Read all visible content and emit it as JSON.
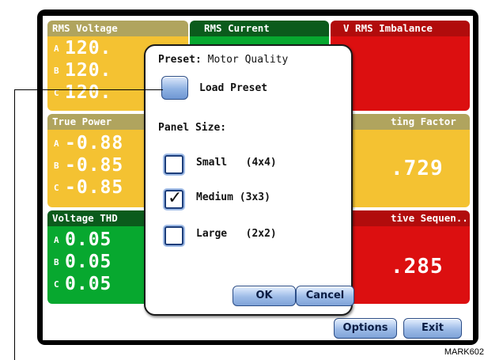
{
  "panels": {
    "rms_voltage": {
      "title": "RMS Voltage",
      "rows": [
        {
          "phase": "A",
          "value": "120."
        },
        {
          "phase": "B",
          "value": "120."
        },
        {
          "phase": "C",
          "value": "120."
        }
      ]
    },
    "rms_current": {
      "title": "RMS Current"
    },
    "v_rms_imbalance": {
      "title": "V RMS Imbalance"
    },
    "true_power": {
      "title": "True Power",
      "rows": [
        {
          "phase": "A",
          "value": "-0.88"
        },
        {
          "phase": "B",
          "value": "-0.85"
        },
        {
          "phase": "C",
          "value": "-0.85"
        }
      ]
    },
    "derating_factor": {
      "title": "ting Factor",
      "value": ".729"
    },
    "voltage_thd": {
      "title": "Voltage THD",
      "rows": [
        {
          "phase": "A",
          "value": "0.05"
        },
        {
          "phase": "B",
          "value": "0.05"
        },
        {
          "phase": "C",
          "value": "0.05"
        }
      ]
    },
    "negative_sequence": {
      "title": "tive Sequen..",
      "value": ".285"
    }
  },
  "buttons": {
    "options": "Options",
    "exit": "Exit"
  },
  "dialog": {
    "preset_label": "Preset:",
    "preset_value": "Motor Quality",
    "load_preset": "Load Preset",
    "panel_size_label": "Panel Size:",
    "sizes": [
      {
        "label": "Small   (4x4)",
        "checked": false
      },
      {
        "label": "Medium (3x3)",
        "checked": true
      },
      {
        "label": "Large   (2x2)",
        "checked": false
      }
    ],
    "ok": "OK",
    "cancel": "Cancel",
    "checkmark": "✓"
  },
  "figure_label": "MARK602",
  "colors": {
    "yellow_header": "#b0a45e",
    "yellow_body": "#f4c232",
    "green_header": "#0b5b1c",
    "green_body": "#07a82f",
    "red_header": "#b10c0c",
    "red_body": "#dc0f10"
  }
}
